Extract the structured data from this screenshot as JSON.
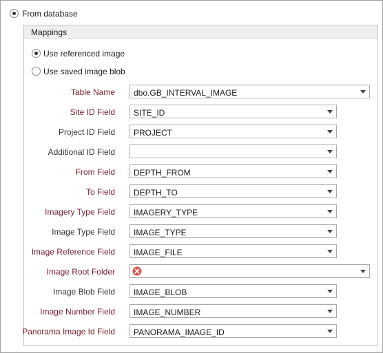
{
  "source": {
    "from_database_label": "From database"
  },
  "mappings": {
    "title": "Mappings",
    "options": {
      "referenced_label": "Use referenced image",
      "saved_blob_label": "Use saved image blob"
    },
    "fields": [
      {
        "label": "Table Name",
        "value": "dbo.GB_INTERVAL_IMAGE",
        "required": true
      },
      {
        "label": "Site ID Field",
        "value": "SITE_ID",
        "required": true
      },
      {
        "label": "Project ID Field",
        "value": "PROJECT",
        "required": false
      },
      {
        "label": "Additional ID Field",
        "value": "",
        "required": false
      },
      {
        "label": "From Field",
        "value": "DEPTH_FROM",
        "required": true
      },
      {
        "label": "To Field",
        "value": "DEPTH_TO",
        "required": true
      },
      {
        "label": "Imagery Type Field",
        "value": "IMAGERY_TYPE",
        "required": true
      },
      {
        "label": "Image Type Field",
        "value": "IMAGE_TYPE",
        "required": false
      },
      {
        "label": "Image Reference Field",
        "value": "IMAGE_FILE",
        "required": true
      },
      {
        "label": "Image Root Folder",
        "value": "",
        "required": true,
        "status_icon": "error-icon"
      },
      {
        "label": "Image Blob Field",
        "value": "IMAGE_BLOB",
        "required": false
      },
      {
        "label": "Image Number Field",
        "value": "IMAGE_NUMBER",
        "required": true
      },
      {
        "label": "Panorama Image Id Field",
        "value": "PANORAMA_IMAGE_ID",
        "required": true
      }
    ]
  },
  "colors": {
    "required_label": "#7a1f2b",
    "error_icon": "#d9534f"
  }
}
